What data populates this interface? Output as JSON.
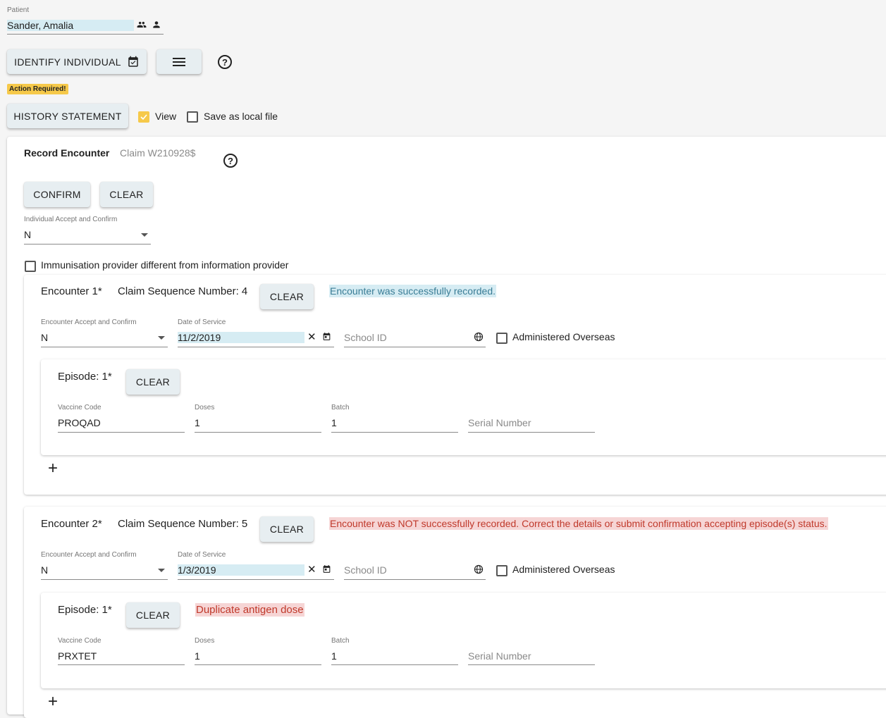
{
  "patient": {
    "label": "Patient",
    "name": "Sander, Amalia"
  },
  "toolbar": {
    "identify_label": "IDENTIFY INDIVIDUAL",
    "help_glyph": "?"
  },
  "action_required": "Action Required!",
  "history": {
    "button_label": "HISTORY STATEMENT",
    "view_label": "View",
    "view_checked": true,
    "save_local_label": "Save as local file",
    "save_local_checked": false
  },
  "record": {
    "title": "Record Encounter",
    "claim": "Claim W210928$",
    "confirm_label": "CONFIRM",
    "clear_label": "CLEAR",
    "accept_label": "Individual Accept and Confirm",
    "accept_value": "N",
    "provider_diff_label": "Immunisation provider different from information provider"
  },
  "encounters": [
    {
      "title": "Encounter 1*",
      "claim_seq": "Claim Sequence Number: 4",
      "clear_label": "CLEAR",
      "status": "Encounter was successfully recorded.",
      "accept_label": "Encounter Accept and Confirm",
      "accept_value": "N",
      "date_label": "Date of Service",
      "date_value": "11/2/2019",
      "school_placeholder": "School ID",
      "overseas_label": "Administered Overseas",
      "episode": {
        "title": "Episode: 1*",
        "clear_label": "CLEAR",
        "vaccine_label": "Vaccine Code",
        "vaccine_value": "PROQAD",
        "doses_label": "Doses",
        "doses_value": "1",
        "batch_label": "Batch",
        "batch_value": "1",
        "serial_placeholder": "Serial Number"
      },
      "add_glyph": "+"
    },
    {
      "title": "Encounter 2*",
      "claim_seq": "Claim Sequence Number: 5",
      "clear_label": "CLEAR",
      "status": "Encounter was NOT successfully recorded. Correct the details or submit confirmation accepting episode(s) status.",
      "accept_label": "Encounter Accept and Confirm",
      "accept_value": "N",
      "date_label": "Date of Service",
      "date_value": "1/3/2019",
      "school_placeholder": "School ID",
      "overseas_label": "Administered Overseas",
      "episode": {
        "title": "Episode: 1*",
        "clear_label": "CLEAR",
        "error": "Duplicate antigen dose",
        "vaccine_label": "Vaccine Code",
        "vaccine_value": "PRXTET",
        "doses_label": "Doses",
        "doses_value": "1",
        "batch_label": "Batch",
        "batch_value": "1",
        "serial_placeholder": "Serial Number"
      },
      "add_glyph": "+"
    }
  ],
  "colors": {
    "success_bg": "#d6ecf3",
    "success_text": "#3a7d96",
    "error_bg": "#f6d5d5",
    "error_text": "#c0392b",
    "badge": "#f6c94a",
    "button_bg": "#e7eef1"
  }
}
